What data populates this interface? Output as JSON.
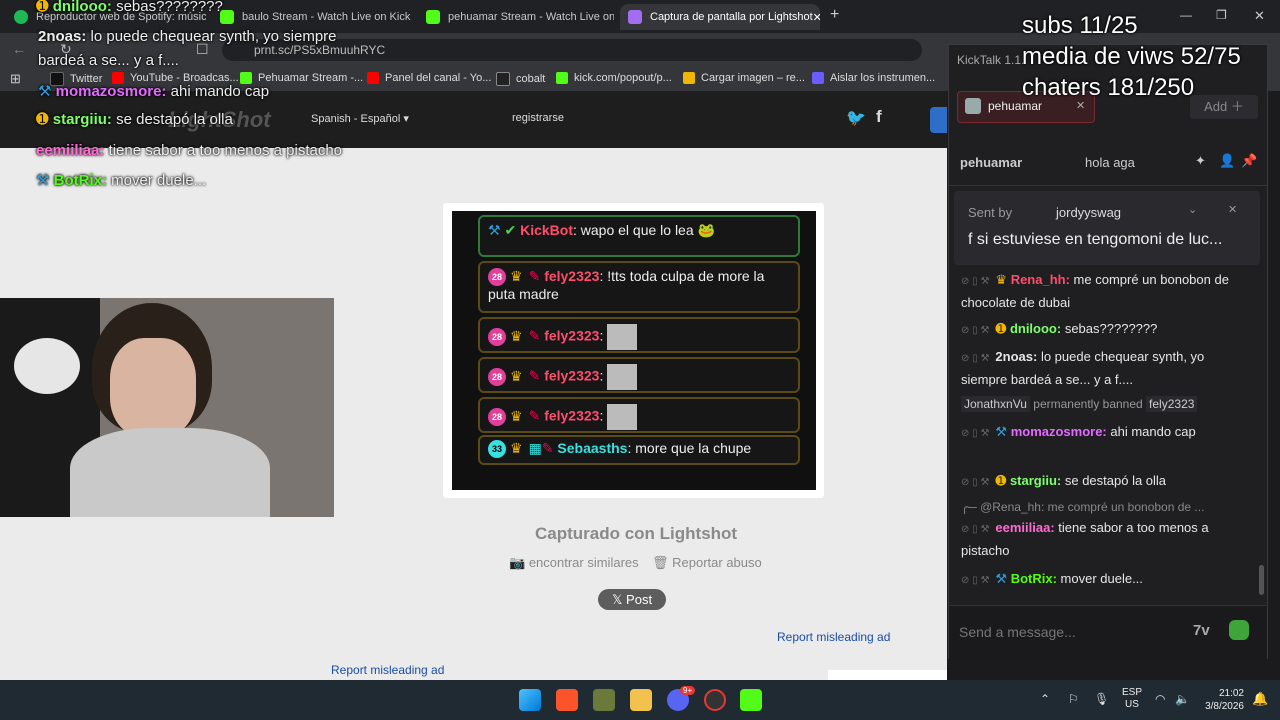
{
  "browser": {
    "tabs": [
      {
        "label": "Reproductor web de Spotify: música",
        "color": "#1db954"
      },
      {
        "label": "baulo Stream - Watch Live on Kick",
        "color": "#53fc18"
      },
      {
        "label": "pehuamar Stream - Watch Live on Kick",
        "color": "#53fc18"
      },
      {
        "label": "Captura de pantalla por Lightshot",
        "color": "#a46cf0"
      }
    ],
    "url": "prnt.sc/PS5xBmuuhRYC",
    "bookmarks": [
      {
        "label": "Twitter",
        "color": "#000000"
      },
      {
        "label": "YouTube - Broadcas...",
        "color": "#ff0000"
      },
      {
        "label": "Pehuamar Stream -...",
        "color": "#53fc18"
      },
      {
        "label": "Panel del canal - Yo...",
        "color": "#ff0000"
      },
      {
        "label": "cobalt",
        "color": "#222222"
      },
      {
        "label": "kick.com/popout/p...",
        "color": "#53fc18"
      },
      {
        "label": "Cargar imagen – re...",
        "color": "#f2b705"
      },
      {
        "label": "Aislar los instrumen...",
        "color": "#6b5cff"
      }
    ]
  },
  "lightshot": {
    "language": "Spanish - Español",
    "register": "registrarse",
    "captured_with": "Capturado con Lightshot",
    "find_similar": "encontrar similares",
    "report_abuse": "Reportar abuso",
    "post": "Post",
    "report_ad_1": "Report misleading ad",
    "report_ad_2": "Report misleading ad",
    "screenshot_chat": [
      {
        "user": "KickBot",
        "text": "wapo el que lo lea",
        "color": "#ff4d6a"
      },
      {
        "user": "fely2323",
        "text": "!tts toda culpa de more la puta madre",
        "color": "#ff4d6a"
      },
      {
        "user": "fely2323",
        "text": "",
        "color": "#ff4d6a"
      },
      {
        "user": "fely2323",
        "text": "",
        "color": "#ff4d6a"
      },
      {
        "user": "fely2323",
        "text": "",
        "color": "#ff4d6a"
      },
      {
        "user": "Sebaasths",
        "text": "more que la chupe",
        "color": "#38e0e0"
      }
    ],
    "badges": {
      "b28": "28",
      "b33": "33"
    }
  },
  "overlay_chat": [
    {
      "user": "dnilooo:",
      "text": "sebas????????",
      "color": "#7dff6a"
    },
    {
      "user": "2noas:",
      "text": "lo puede chequear synth, yo siempre",
      "color": "#ffffff"
    },
    {
      "user": "",
      "text": "bardeá a se... y a f....",
      "color": "#ffffff"
    },
    {
      "user": "momazosmore:",
      "text": "ahi mando cap",
      "color": "#e36bff"
    },
    {
      "user": "stargiiu:",
      "text": "se destapó la olla",
      "color": "#7dff6a"
    },
    {
      "user": "eemiiliaa:",
      "text": "tiene sabor a too menos a pistacho",
      "color": "#ff6ad1"
    },
    {
      "user": "BotRix:",
      "text": "mover duele...",
      "color": "#53fc18"
    }
  ],
  "stats": {
    "line1": "subs 11/25",
    "line2": "media de viws  52/75",
    "line3": "chaters 181/250"
  },
  "kicktalk": {
    "title": "KickTalk 1.1.",
    "channel_tab": "pehuamar",
    "add_label": "Add",
    "pinned": {
      "user": "pehuamar",
      "text": "hola aga"
    },
    "sent_by_label": "Sent by",
    "sent_by_user": "jordyyswag",
    "sent_text": "f si estuviese en tengomoni de luc...",
    "messages": [
      {
        "user": "Rena_hh:",
        "text": "me compré un bonobon de chocolate de dubai",
        "color": "#ff4d6a"
      },
      {
        "user": "dnilooo:",
        "text": "sebas????????",
        "color": "#7dff6a"
      },
      {
        "user": "2noas:",
        "text": "lo puede chequear synth, yo siempre bardeá a se... y a f....",
        "color": "#ffffff"
      },
      {
        "user": "momazosmore:",
        "text": "ahi mando cap",
        "color": "#e36bff"
      },
      {
        "user": "stargiiu:",
        "text": "se destapó la olla",
        "color": "#7dff6a"
      },
      {
        "user": "eemiiliaa:",
        "text": "tiene sabor a too menos a pistacho",
        "color": "#ff6ad1"
      },
      {
        "user": "BotRix:",
        "text": "mover duele...",
        "color": "#53fc18"
      }
    ],
    "ban": {
      "mod": "JonathxnVu",
      "action": "permanently banned",
      "target": "fely2323"
    },
    "reply": "@Rena_hh: me compré un bonobon de ...",
    "input_placeholder": "Send a message..."
  },
  "taskbar": {
    "lang": "ESP",
    "region": "US",
    "time": "21:02",
    "date": "3/8/2026",
    "notif_badge": "9+"
  }
}
